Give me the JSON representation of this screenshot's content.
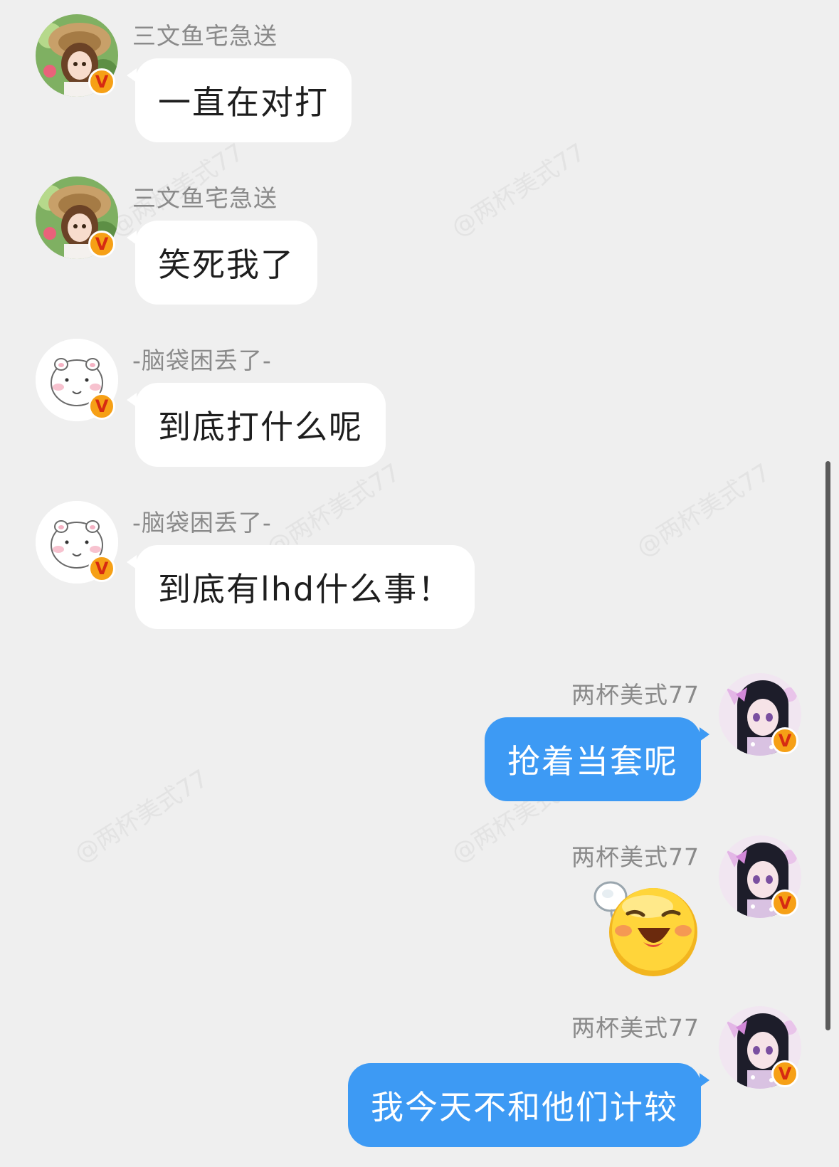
{
  "messages": [
    {
      "sender": "三文鱼宅急送",
      "text": "一直在对打"
    },
    {
      "sender": "三文鱼宅急送",
      "text": "笑死我了"
    },
    {
      "sender": "-脑袋困丢了-",
      "text": "到底打什么呢"
    },
    {
      "sender": "-脑袋困丢了-",
      "text": "到底有lhd什么事！"
    },
    {
      "sender": "两杯美式77",
      "text": "抢着当套呢"
    },
    {
      "sender": "两杯美式77",
      "emoji": "sigh-relief-emoji"
    },
    {
      "sender": "两杯美式77",
      "text": "我今天不和他们计较"
    }
  ],
  "badge": {
    "label": "V",
    "color": "#f6a016",
    "text_color": "#d62a12"
  },
  "watermark": "@两杯美式77",
  "colors": {
    "background": "#efefef",
    "incoming_bubble": "#ffffff",
    "outgoing_bubble": "#3d9af4",
    "name_text": "#8a8a8a"
  }
}
